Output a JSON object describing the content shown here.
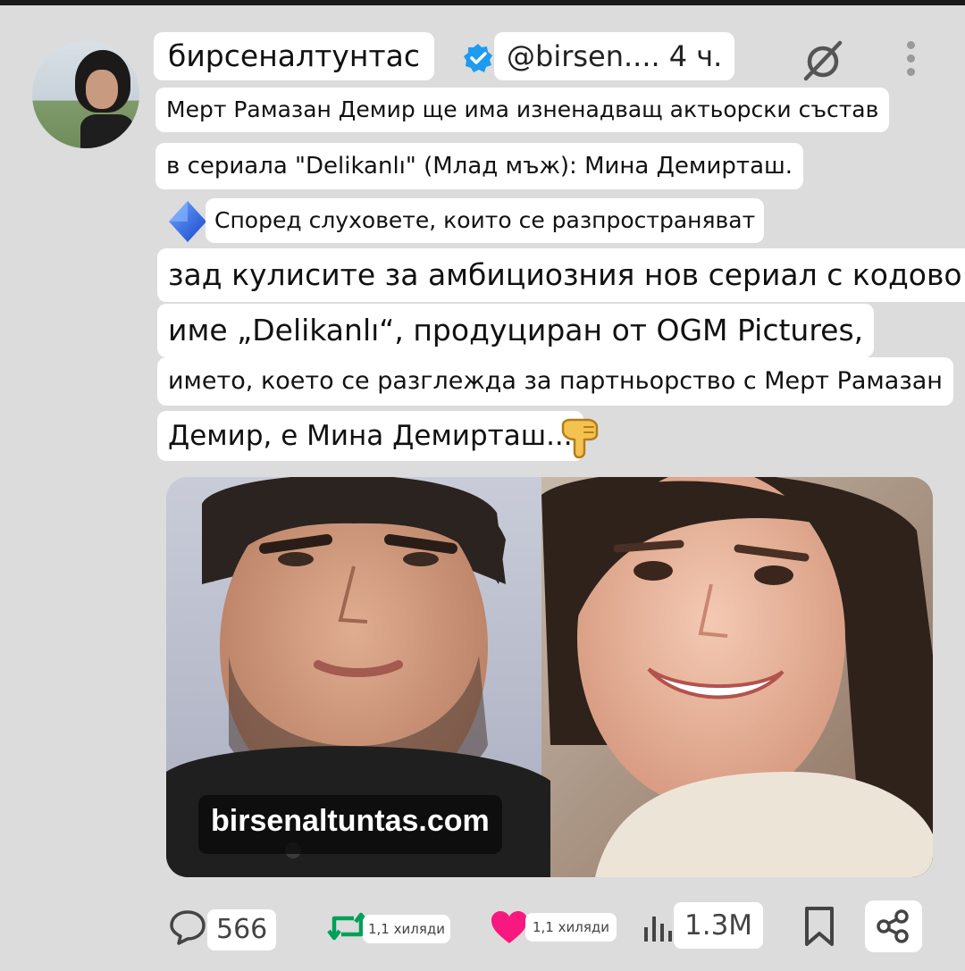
{
  "author": {
    "display_name": "бирсеналтунтас",
    "handle": "@birsen....",
    "time": "4 ч."
  },
  "post": {
    "line1": "Мерт Рамазан Демир ще има изненадващ актьорски състав",
    "line2": "в сериала \"Delikanlı\" (Млад мъж): Мина Демирташ.",
    "line3": "Според слуховете, които се разпространяват",
    "line4": "зад кулисите за амбициозния нов сериал с кодово",
    "line5": "име „Delikanlı“, продуциран от OGM Pictures,",
    "line6": "името, което се разглежда за партньорство с Мерт Рамазан",
    "line7": "Демир, е Мина Демирташ..."
  },
  "media": {
    "watermark": "birsenaltuntas.com"
  },
  "actions": {
    "replies": "566",
    "reposts": "1,1 хиляди",
    "likes": "1,1 хиляди",
    "views": "1.3M"
  },
  "colors": {
    "verified": "#1d9bf0",
    "repost": "#00a05a",
    "like": "#f91880",
    "background": "#dcdcdc"
  },
  "icons": [
    "verified-badge-icon",
    "grok-icon",
    "more-icon",
    "blue-diamond-icon",
    "pointing-down-icon",
    "reply-icon",
    "repost-icon",
    "like-icon",
    "views-icon",
    "bookmark-icon",
    "share-icon"
  ]
}
